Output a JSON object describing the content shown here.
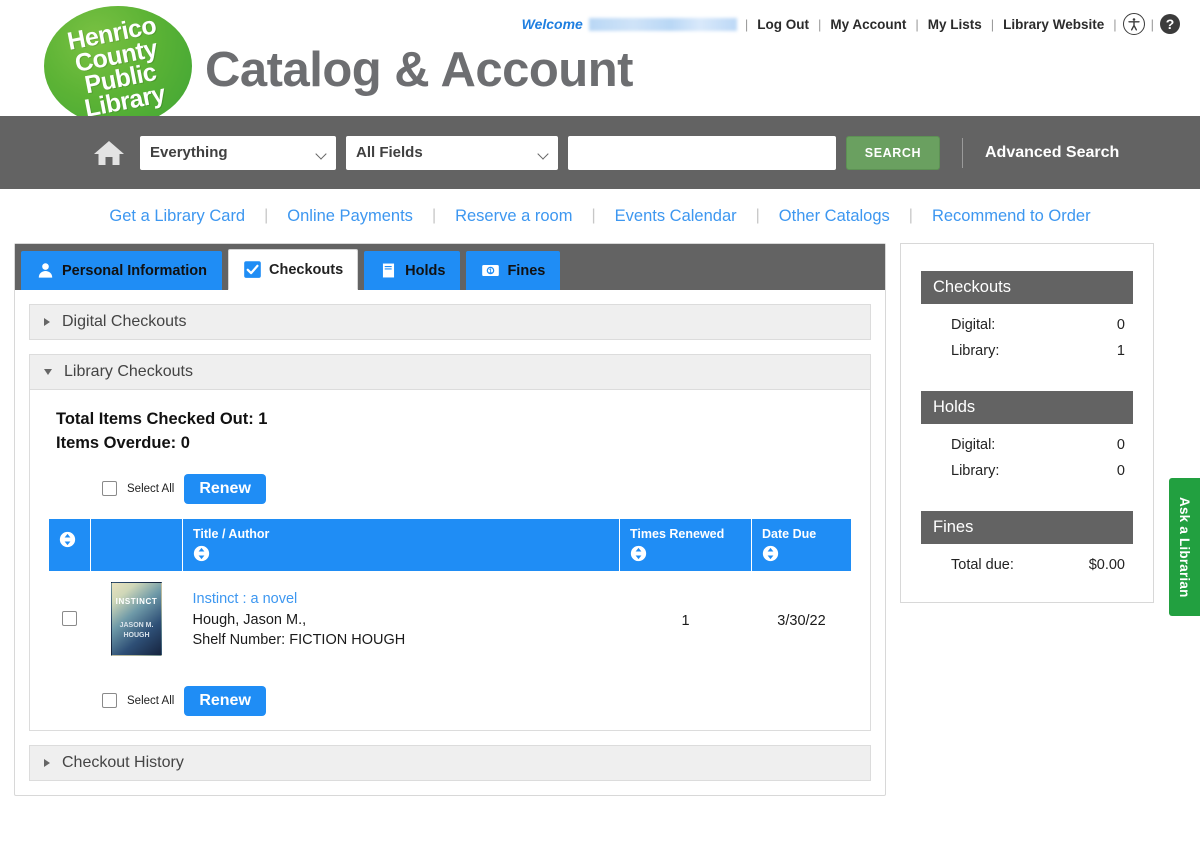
{
  "header": {
    "logo_lines": [
      "Henrico",
      "County",
      "Public",
      "Library"
    ],
    "site_title": "Catalog & Account",
    "welcome_label": "Welcome",
    "welcome_name_redacted": "",
    "nav_links": [
      "Log Out",
      "My Account",
      "My Lists",
      "Library Website"
    ],
    "separator": "|",
    "accessibility_icon": "accessibility-icon",
    "help_icon": "help-icon",
    "help_glyph": "?"
  },
  "search": {
    "home_icon": "home-icon",
    "scope_selected": "Everything",
    "scope_options": [
      "Everything"
    ],
    "field_selected": "All Fields",
    "field_options": [
      "All Fields"
    ],
    "query_value": "",
    "query_placeholder": "",
    "search_button": "SEARCH",
    "advanced_search": "Advanced Search"
  },
  "quicklinks": [
    "Get a Library Card",
    "Online Payments",
    "Reserve a room",
    "Events Calendar",
    "Other Catalogs",
    "Recommend to Order"
  ],
  "tabs": [
    {
      "label": "Personal Information",
      "icon": "user-icon",
      "active": false
    },
    {
      "label": "Checkouts",
      "icon": "checkbox-checked-icon",
      "active": true
    },
    {
      "label": "Holds",
      "icon": "book-icon",
      "active": false
    },
    {
      "label": "Fines",
      "icon": "money-icon",
      "active": false
    }
  ],
  "accordions": {
    "digital": {
      "label": "Digital Checkouts",
      "expanded": false
    },
    "library": {
      "label": "Library Checkouts",
      "expanded": true
    },
    "history": {
      "label": "Checkout History",
      "expanded": false
    }
  },
  "checkouts": {
    "total_label": "Total Items Checked Out: 1",
    "overdue_label": "Items Overdue: 0",
    "select_all_label": "Select All",
    "renew_label": "Renew",
    "columns": [
      "",
      "",
      "Title / Author",
      "Times Renewed",
      "Date Due"
    ],
    "rows": [
      {
        "title": "Instinct : a novel",
        "author": "Hough, Jason M.,",
        "shelf": "Shelf Number: FICTION HOUGH",
        "times_renewed": "1",
        "date_due": "3/30/22",
        "cover_title": "INSTINCT",
        "cover_author_1": "JASON M.",
        "cover_author_2": "HOUGH"
      }
    ]
  },
  "sidebar": {
    "sections": [
      {
        "heading": "Checkouts",
        "rows": [
          {
            "label": "Digital:",
            "value": "0"
          },
          {
            "label": "Library:",
            "value": "1"
          }
        ]
      },
      {
        "heading": "Holds",
        "rows": [
          {
            "label": "Digital:",
            "value": "0"
          },
          {
            "label": "Library:",
            "value": "0"
          }
        ]
      },
      {
        "heading": "Fines",
        "rows": [
          {
            "label": "Total due:",
            "value": "$0.00"
          }
        ]
      }
    ]
  },
  "ask_librarian": {
    "label": "Ask a Librarian"
  },
  "colors": {
    "brand_green": "#3fa535",
    "accent_blue": "#1f8df5",
    "link_blue": "#3d97f0",
    "bar_gray": "#636363",
    "search_green": "#6aa060",
    "ask_green": "#22a040"
  }
}
